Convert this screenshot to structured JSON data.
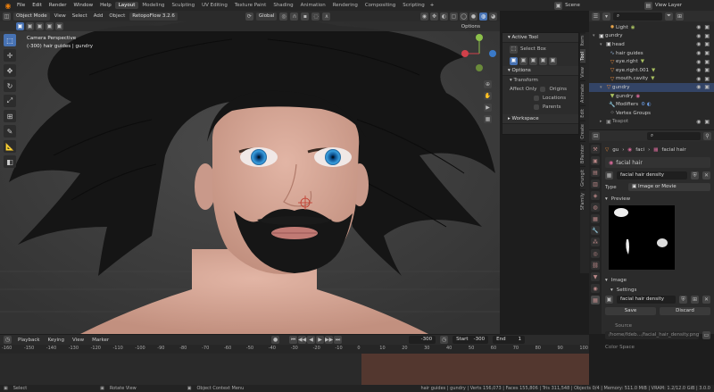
{
  "topbar": {
    "menus": [
      "File",
      "Edit",
      "Render",
      "Window",
      "Help"
    ],
    "workspaces": [
      "Layout",
      "Modeling",
      "Sculpting",
      "UV Editing",
      "Texture Paint",
      "Shading",
      "Animation",
      "Rendering",
      "Compositing",
      "Scripting"
    ],
    "active_workspace": "Layout",
    "scene_label": "Scene",
    "view_layer_label": "View Layer"
  },
  "viewport_header": {
    "mode": "Object Mode",
    "menus": [
      "View",
      "Select",
      "Add",
      "Object"
    ],
    "addon": "RetopoFlow 3.2.6",
    "transform_orientation": "Global",
    "options_label": "Options"
  },
  "viewport": {
    "view_name": "Camera Perspective",
    "collection_info": "(-300) hair guides | gundry"
  },
  "npanel": {
    "active_tool_header": "Active Tool",
    "select_box_label": "Select Box",
    "options_header": "Options",
    "transform_header": "Transform",
    "affect_only_label": "Affect Only",
    "origins_label": "Origins",
    "locations_label": "Locations",
    "parents_label": "Parents",
    "workspace_header": "Workspace",
    "tabs": [
      "Item",
      "Tool",
      "View",
      "Animate",
      "Edit",
      "Create",
      "BPainter",
      "Grungit",
      "SFamily"
    ]
  },
  "outliner": {
    "rows": [
      {
        "name": "Light",
        "indent": 2
      },
      {
        "name": "gundry",
        "indent": 0
      },
      {
        "name": "head",
        "indent": 1
      },
      {
        "name": "hair guides",
        "indent": 2
      },
      {
        "name": "eye.right",
        "indent": 2
      },
      {
        "name": "eye.right.001",
        "indent": 2
      },
      {
        "name": "mouth.cavity",
        "indent": 2
      },
      {
        "name": "gundry",
        "indent": 1
      },
      {
        "name": "gundry",
        "indent": 2
      },
      {
        "name": "Modifiers",
        "indent": 2
      },
      {
        "name": "Vertex Groups",
        "indent": 2
      },
      {
        "name": "Teapot",
        "indent": 1
      }
    ]
  },
  "properties": {
    "breadcrumb": [
      "gu",
      "faci",
      "facial hair"
    ],
    "material_name": "facial hair",
    "texture_name": "facial hair density",
    "type_label": "Type",
    "type_value": "Image or Movie",
    "preview_header": "Preview",
    "image_header": "Image",
    "settings_header": "Settings",
    "image_name": "facial hair density",
    "save_label": "Save",
    "discard_label": "Discard",
    "source_label": "Source",
    "filepath": "/home/fdeb.../facial_hair_density.png",
    "colorspace_label": "Color Space"
  },
  "timeline": {
    "menus": [
      "Playback",
      "Keying",
      "View",
      "Marker"
    ],
    "current_frame": "-300",
    "start_label": "Start",
    "start_value": "-300",
    "end_label": "End",
    "end_value": "1",
    "ticks": [
      "-160",
      "-150",
      "-140",
      "-130",
      "-120",
      "-110",
      "-100",
      "-90",
      "-80",
      "-70",
      "-60",
      "-50",
      "-40",
      "-30",
      "-20",
      "-10",
      "0",
      "10",
      "20",
      "30",
      "40",
      "50",
      "60",
      "70",
      "80",
      "90",
      "100"
    ]
  },
  "statusbar": {
    "left": "Select",
    "middle1": "Rotate View",
    "middle2": "Object Context Menu",
    "stats": "hair guides | gundry | Verts 156,073 | Faces 155,806 | Tris 311,548 | Objects 0/4 | Memory: 511.0 MiB | VRAM: 1.2/12.0 GiB | 3.0.0"
  }
}
